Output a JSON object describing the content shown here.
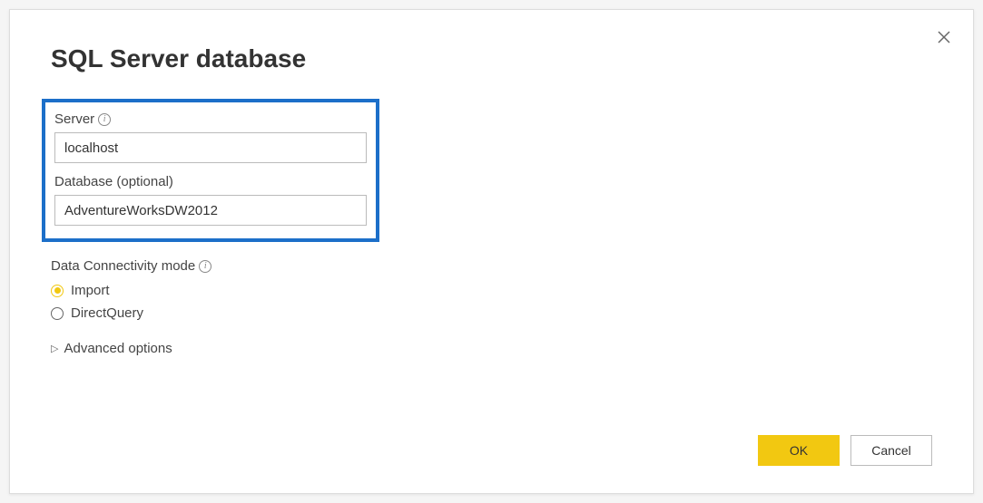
{
  "dialog": {
    "title": "SQL Server database"
  },
  "fields": {
    "server": {
      "label": "Server",
      "value": "localhost"
    },
    "database": {
      "label": "Database (optional)",
      "value": "AdventureWorksDW2012"
    }
  },
  "connectivity": {
    "label": "Data Connectivity mode",
    "options": {
      "import": "Import",
      "directquery": "DirectQuery"
    },
    "selected": "import"
  },
  "advanced": {
    "label": "Advanced options"
  },
  "buttons": {
    "ok": "OK",
    "cancel": "Cancel"
  }
}
